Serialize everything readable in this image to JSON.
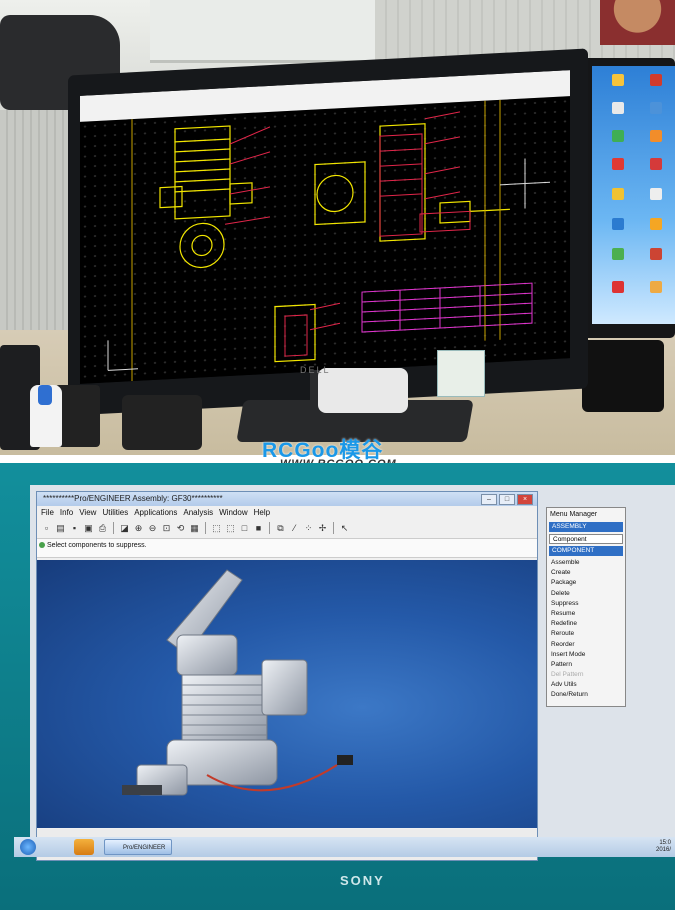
{
  "watermark": {
    "logo_text": "RCGoo模谷",
    "url": "WWW.RCGOO.COM"
  },
  "top_photo": {
    "monitor_brand": "DELL"
  },
  "proe": {
    "window_title": "**********Pro/ENGINEER Assembly: GF30**********",
    "menu": [
      "File",
      "Info",
      "View",
      "Utilities",
      "Applications",
      "Analysis",
      "Window",
      "Help"
    ],
    "message": "Select components to suppress.",
    "menu_manager": {
      "title": "Menu Manager",
      "assembly": "ASSEMBLY",
      "dropdown": "Component",
      "component": "COMPONENT",
      "items": [
        {
          "label": "Assemble",
          "enabled": true
        },
        {
          "label": "Create",
          "enabled": true
        },
        {
          "label": "Package",
          "enabled": true
        },
        {
          "label": "Delete",
          "enabled": true
        },
        {
          "label": "Suppress",
          "enabled": true
        },
        {
          "label": "Resume",
          "enabled": true
        },
        {
          "label": "Redefine",
          "enabled": true
        },
        {
          "label": "Reroute",
          "enabled": true
        },
        {
          "label": "Reorder",
          "enabled": true
        },
        {
          "label": "Insert Mode",
          "enabled": true
        },
        {
          "label": "Pattern",
          "enabled": true
        },
        {
          "label": "Del Pattern",
          "enabled": false
        },
        {
          "label": "Adv Utils",
          "enabled": true
        },
        {
          "label": "Done/Return",
          "enabled": true
        }
      ]
    },
    "taskbar_task": "Pro/ENGINEER",
    "tray_time": "15:0",
    "tray_date": "2016/"
  },
  "laptop_brand": "SONY"
}
